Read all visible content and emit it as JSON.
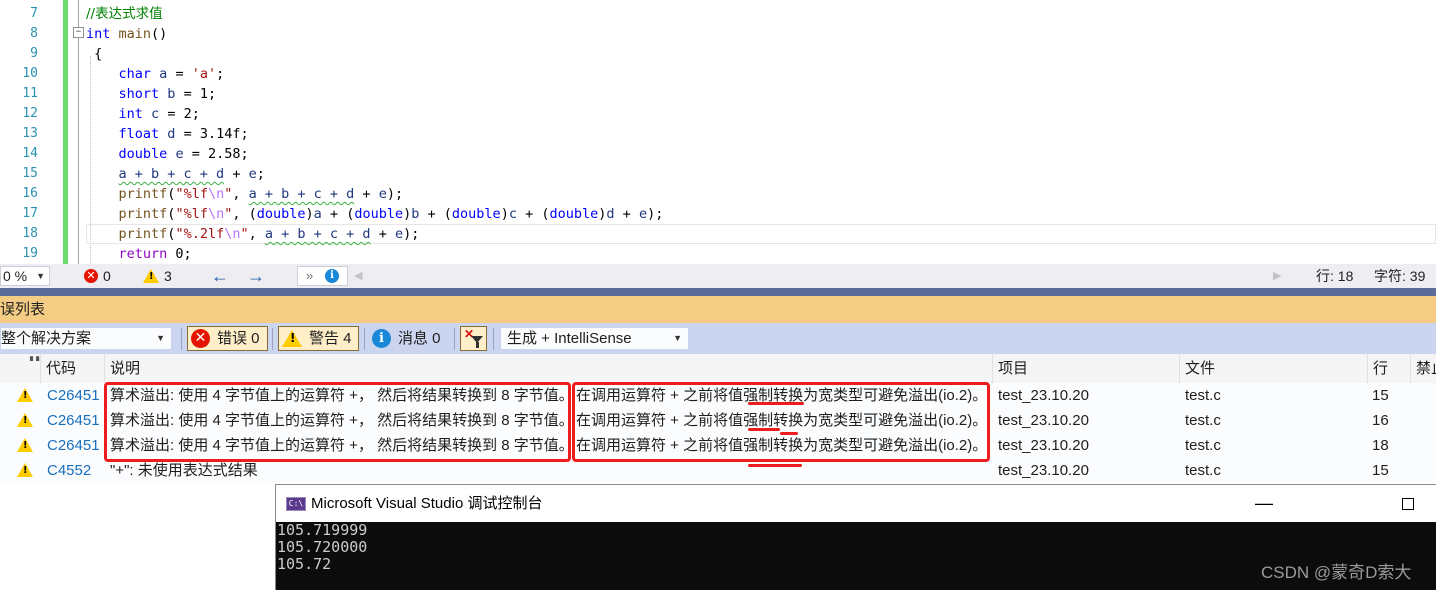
{
  "editor": {
    "lines": [
      {
        "num": "7",
        "segments": [
          {
            "t": "//表达式求值",
            "c": "cmt"
          }
        ]
      },
      {
        "num": "8",
        "segments": [
          {
            "t": "int",
            "c": "kw"
          },
          {
            "t": " "
          },
          {
            "t": "main",
            "c": "fn"
          },
          {
            "t": "()"
          }
        ]
      },
      {
        "num": "9",
        "segments": [
          {
            "t": " {"
          }
        ]
      },
      {
        "num": "10",
        "segments": [
          {
            "t": "    "
          },
          {
            "t": "char",
            "c": "kw"
          },
          {
            "t": " "
          },
          {
            "t": "a",
            "c": "var"
          },
          {
            "t": " = "
          },
          {
            "t": "'a'",
            "c": "str"
          },
          {
            "t": ";"
          }
        ]
      },
      {
        "num": "11",
        "segments": [
          {
            "t": "    "
          },
          {
            "t": "short",
            "c": "kw"
          },
          {
            "t": " "
          },
          {
            "t": "b",
            "c": "var"
          },
          {
            "t": " = 1;"
          }
        ]
      },
      {
        "num": "12",
        "segments": [
          {
            "t": "    "
          },
          {
            "t": "int",
            "c": "kw"
          },
          {
            "t": " "
          },
          {
            "t": "c",
            "c": "var"
          },
          {
            "t": " = 2;"
          }
        ]
      },
      {
        "num": "13",
        "segments": [
          {
            "t": "    "
          },
          {
            "t": "float",
            "c": "kw"
          },
          {
            "t": " "
          },
          {
            "t": "d",
            "c": "var"
          },
          {
            "t": " = 3.14f;"
          }
        ]
      },
      {
        "num": "14",
        "segments": [
          {
            "t": "    "
          },
          {
            "t": "double",
            "c": "kw"
          },
          {
            "t": " "
          },
          {
            "t": "e",
            "c": "var"
          },
          {
            "t": " = 2.58;"
          }
        ]
      },
      {
        "num": "15",
        "segments": [
          {
            "t": "    "
          },
          {
            "t": "a + b + c + d",
            "c": "var squig"
          },
          {
            "t": " + "
          },
          {
            "t": "e",
            "c": "var"
          },
          {
            "t": ";"
          }
        ]
      },
      {
        "num": "16",
        "segments": [
          {
            "t": "    "
          },
          {
            "t": "printf",
            "c": "fn"
          },
          {
            "t": "("
          },
          {
            "t": "\"%lf",
            "c": "str"
          },
          {
            "t": "\\n",
            "c": "esc"
          },
          {
            "t": "\"",
            "c": "str"
          },
          {
            "t": ", "
          },
          {
            "t": "a + b + c + d",
            "c": "var squig"
          },
          {
            "t": " + "
          },
          {
            "t": "e",
            "c": "var"
          },
          {
            "t": ");"
          }
        ]
      },
      {
        "num": "17",
        "segments": [
          {
            "t": "    "
          },
          {
            "t": "printf",
            "c": "fn"
          },
          {
            "t": "("
          },
          {
            "t": "\"%lf",
            "c": "str"
          },
          {
            "t": "\\n",
            "c": "esc"
          },
          {
            "t": "\"",
            "c": "str"
          },
          {
            "t": ", ("
          },
          {
            "t": "double",
            "c": "kw"
          },
          {
            "t": ")"
          },
          {
            "t": "a",
            "c": "var"
          },
          {
            "t": " + ("
          },
          {
            "t": "double",
            "c": "kw"
          },
          {
            "t": ")"
          },
          {
            "t": "b",
            "c": "var"
          },
          {
            "t": " + ("
          },
          {
            "t": "double",
            "c": "kw"
          },
          {
            "t": ")"
          },
          {
            "t": "c",
            "c": "var"
          },
          {
            "t": " + ("
          },
          {
            "t": "double",
            "c": "kw"
          },
          {
            "t": ")"
          },
          {
            "t": "d",
            "c": "var"
          },
          {
            "t": " + "
          },
          {
            "t": "e",
            "c": "var"
          },
          {
            "t": ");"
          }
        ]
      },
      {
        "num": "18",
        "segments": [
          {
            "t": "    "
          },
          {
            "t": "printf",
            "c": "fn"
          },
          {
            "t": "("
          },
          {
            "t": "\"%.2lf",
            "c": "str"
          },
          {
            "t": "\\n",
            "c": "esc"
          },
          {
            "t": "\"",
            "c": "str"
          },
          {
            "t": ", "
          },
          {
            "t": "a + b + c + d",
            "c": "var squig"
          },
          {
            "t": " + "
          },
          {
            "t": "e",
            "c": "var"
          },
          {
            "t": ");"
          }
        ]
      },
      {
        "num": "19",
        "segments": [
          {
            "t": "    "
          },
          {
            "t": "return",
            "c": "kw-ctl"
          },
          {
            "t": " 0;"
          }
        ]
      }
    ]
  },
  "edit_strip": {
    "zoom_value": "0 %",
    "error_count": "0",
    "warning_count": "3",
    "back_arrow": "←",
    "forward_arrow": "→",
    "nav_chevron": "»",
    "line_label": "行: 18",
    "char_label": "字符: 39"
  },
  "error_list": {
    "title": "误列表",
    "scope": "整个解决方案",
    "errors_btn": "错误 0",
    "warnings_btn": "警告 4",
    "messages_btn": "消息 0",
    "source": "生成 + IntelliSense",
    "columns": {
      "code": "代码",
      "description": "说明",
      "project": "项目",
      "file": "文件",
      "line": "行",
      "suppress": "禁止"
    },
    "rows": [
      {
        "code": "C26451",
        "desc1": "算术溢出: 使用 4 字节值上的运算符 +， 然后将结果转换到 8 字节值。",
        "desc2": "在调用运算符 + 之前将值强制转换为宽类型可避免溢出(io.2)。",
        "project": "test_23.10.20",
        "file": "test.c",
        "line": "15"
      },
      {
        "code": "C26451",
        "desc1": "算术溢出: 使用 4 字节值上的运算符 +， 然后将结果转换到 8 字节值。",
        "desc2": "在调用运算符 + 之前将值强制转换为宽类型可避免溢出(io.2)。",
        "project": "test_23.10.20",
        "file": "test.c",
        "line": "16"
      },
      {
        "code": "C26451",
        "desc1": "算术溢出: 使用 4 字节值上的运算符 +， 然后将结果转换到 8 字节值。",
        "desc2": "在调用运算符 + 之前将值强制转换为宽类型可避免溢出(io.2)。",
        "project": "test_23.10.20",
        "file": "test.c",
        "line": "18"
      },
      {
        "code": "C4552",
        "desc1": "\"+\": 未使用表达式结果",
        "desc2": "",
        "project": "test_23.10.20",
        "file": "test.c",
        "line": "15"
      }
    ],
    "annotation_color": "#ee1c1c"
  },
  "console": {
    "icon_text": "C:\\",
    "title": "Microsoft Visual Studio 调试控制台",
    "minimize": "—",
    "output": [
      "105.719999",
      "105.720000",
      "105.72"
    ],
    "watermark": "CSDN @蒙奇D索大"
  }
}
